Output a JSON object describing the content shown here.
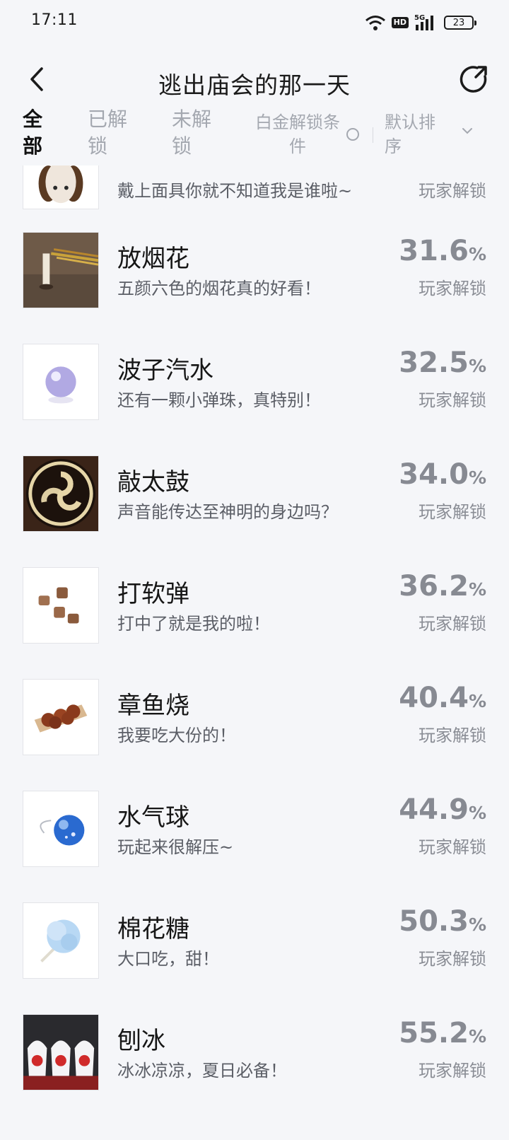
{
  "status_bar": {
    "time": "17:11",
    "hd": "HD",
    "network": "5G",
    "battery": "23"
  },
  "header": {
    "title": "逃出庙会的那一天"
  },
  "filters": {
    "all": "全部",
    "unlocked": "已解锁",
    "locked": "未解锁",
    "platinum": "白金解锁条件",
    "sort": "默认排序"
  },
  "unlock_label": "玩家解锁",
  "partial_item": {
    "desc": "戴上面具你就不知道我是谁啦~",
    "unlock_label": "玩家解锁"
  },
  "achievements": [
    {
      "name": "放烟花",
      "desc": "五颜六色的烟花真的好看！",
      "pct": "31.6",
      "unit": "%",
      "icon": "fireworks-icon"
    },
    {
      "name": "波子汽水",
      "desc": "还有一颗小弹珠，真特别！",
      "pct": "32.5",
      "unit": "%",
      "icon": "marble-icon"
    },
    {
      "name": "敲太鼓",
      "desc": "声音能传达至神明的身边吗？",
      "pct": "34.0",
      "unit": "%",
      "icon": "taiko-drum-icon"
    },
    {
      "name": "打软弹",
      "desc": "打中了就是我的啦！",
      "pct": "36.2",
      "unit": "%",
      "icon": "corks-icon"
    },
    {
      "name": "章鱼烧",
      "desc": "我要吃大份的！",
      "pct": "40.4",
      "unit": "%",
      "icon": "takoyaki-icon"
    },
    {
      "name": "水气球",
      "desc": "玩起来很解压~",
      "pct": "44.9",
      "unit": "%",
      "icon": "water-balloon-icon"
    },
    {
      "name": "棉花糖",
      "desc": "大口吃，甜！",
      "pct": "50.3",
      "unit": "%",
      "icon": "cotton-candy-icon"
    },
    {
      "name": "刨冰",
      "desc": "冰冰凉凉，夏日必备！",
      "pct": "55.2",
      "unit": "%",
      "icon": "shaved-ice-icon"
    }
  ]
}
